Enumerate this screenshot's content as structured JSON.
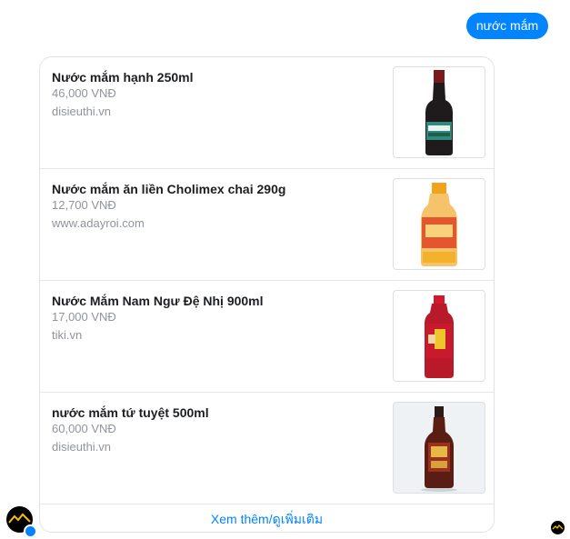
{
  "user_message": {
    "text": "nước mắm"
  },
  "results": [
    {
      "title": "Nước mắm hạnh 250ml",
      "price": "46,000 VNĐ",
      "source": "disieuthi.vn",
      "image_icon": "fish-sauce-bottle-dark"
    },
    {
      "title": "Nước mắm ăn liền Cholimex chai 290g",
      "price": "12,700 VNĐ",
      "source": "www.adayroi.com",
      "image_icon": "fish-sauce-bottle-orange"
    },
    {
      "title": "Nước Mắm Nam Ngư Đệ Nhị 900ml",
      "price": "17,000 VNĐ",
      "source": "tiki.vn",
      "image_icon": "fish-sauce-bottle-red"
    },
    {
      "title": "nước mắm tứ tuyệt 500ml",
      "price": "60,000 VNĐ",
      "source": "disieuthi.vn",
      "image_icon": "fish-sauce-bottle-brown"
    }
  ],
  "more_button": {
    "label": "Xem thêm/ดูเพิ่มเติม"
  },
  "colors": {
    "accent": "#0084ff",
    "secondary_text": "#90949c"
  }
}
